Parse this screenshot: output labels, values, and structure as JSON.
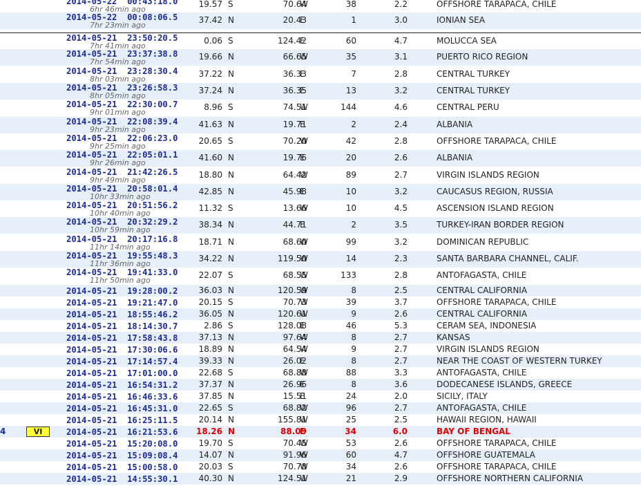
{
  "rows": [
    {
      "date": "2014-05-22",
      "time": "00:43:18.0",
      "ago": "6hr 46min ago",
      "lat": "19.57",
      "ns": "S",
      "lon": "70.64",
      "ew": "W",
      "depth": "38",
      "mag": "2.2",
      "region": "OFFSHORE TARAPACA, CHILE"
    },
    {
      "date": "2014-05-22",
      "time": "00:08:06.5",
      "ago": "7hr 23min ago",
      "lat": "37.42",
      "ns": "N",
      "lon": "20.43",
      "ew": "E",
      "depth": "1",
      "mag": "3.0",
      "region": "IONIAN SEA"
    },
    {
      "date": "2014-05-21",
      "time": "23:50:20.5",
      "ago": "7hr 41min ago",
      "lat": "0.06",
      "ns": "S",
      "lon": "124.42",
      "ew": "E",
      "depth": "60",
      "mag": "4.7",
      "region": "MOLUCCA SEA"
    },
    {
      "date": "2014-05-21",
      "time": "23:37:38.8",
      "ago": "7hr 54min ago",
      "lat": "19.66",
      "ns": "N",
      "lon": "66.65",
      "ew": "W",
      "depth": "35",
      "mag": "3.1",
      "region": "PUERTO RICO REGION"
    },
    {
      "date": "2014-05-21",
      "time": "23:28:30.4",
      "ago": "8hr 03min ago",
      "lat": "37.22",
      "ns": "N",
      "lon": "36.33",
      "ew": "E",
      "depth": "7",
      "mag": "2.8",
      "region": "CENTRAL TURKEY"
    },
    {
      "date": "2014-05-21",
      "time": "23:26:58.3",
      "ago": "8hr 05min ago",
      "lat": "37.24",
      "ns": "N",
      "lon": "36.35",
      "ew": "E",
      "depth": "13",
      "mag": "3.2",
      "region": "CENTRAL TURKEY"
    },
    {
      "date": "2014-05-21",
      "time": "22:30:00.7",
      "ago": "9hr 01min ago",
      "lat": "8.96",
      "ns": "S",
      "lon": "74.51",
      "ew": "W",
      "depth": "144",
      "mag": "4.6",
      "region": "CENTRAL PERU"
    },
    {
      "date": "2014-05-21",
      "time": "22:08:39.4",
      "ago": "9hr 23min ago",
      "lat": "41.63",
      "ns": "N",
      "lon": "19.71",
      "ew": "E",
      "depth": "2",
      "mag": "2.4",
      "region": "ALBANIA"
    },
    {
      "date": "2014-05-21",
      "time": "22:06:23.0",
      "ago": "9hr 25min ago",
      "lat": "20.65",
      "ns": "S",
      "lon": "70.20",
      "ew": "W",
      "depth": "42",
      "mag": "2.8",
      "region": "OFFSHORE TARAPACA, CHILE"
    },
    {
      "date": "2014-05-21",
      "time": "22:05:01.1",
      "ago": "9hr 26min ago",
      "lat": "41.60",
      "ns": "N",
      "lon": "19.76",
      "ew": "E",
      "depth": "20",
      "mag": "2.6",
      "region": "ALBANIA"
    },
    {
      "date": "2014-05-21",
      "time": "21:42:26.5",
      "ago": "9hr 49min ago",
      "lat": "18.80",
      "ns": "N",
      "lon": "64.42",
      "ew": "W",
      "depth": "89",
      "mag": "2.7",
      "region": "VIRGIN ISLANDS REGION"
    },
    {
      "date": "2014-05-21",
      "time": "20:58:01.4",
      "ago": "10hr 33min ago",
      "lat": "42.85",
      "ns": "N",
      "lon": "45.98",
      "ew": "E",
      "depth": "10",
      "mag": "3.2",
      "region": "CAUCASUS REGION, RUSSIA"
    },
    {
      "date": "2014-05-21",
      "time": "20:51:56.2",
      "ago": "10hr 40min ago",
      "lat": "11.32",
      "ns": "S",
      "lon": "13.66",
      "ew": "W",
      "depth": "10",
      "mag": "4.5",
      "region": "ASCENSION ISLAND REGION"
    },
    {
      "date": "2014-05-21",
      "time": "20:32:29.2",
      "ago": "10hr 59min ago",
      "lat": "38.34",
      "ns": "N",
      "lon": "44.71",
      "ew": "E",
      "depth": "2",
      "mag": "3.5",
      "region": "TURKEY-IRAN BORDER REGION"
    },
    {
      "date": "2014-05-21",
      "time": "20:17:16.8",
      "ago": "11hr 14min ago",
      "lat": "18.71",
      "ns": "N",
      "lon": "68.60",
      "ew": "W",
      "depth": "99",
      "mag": "3.2",
      "region": "DOMINICAN REPUBLIC"
    },
    {
      "date": "2014-05-21",
      "time": "19:55:48.3",
      "ago": "11hr 36min ago",
      "lat": "34.22",
      "ns": "N",
      "lon": "119.50",
      "ew": "W",
      "depth": "14",
      "mag": "2.3",
      "region": "SANTA BARBARA CHANNEL, CALIF."
    },
    {
      "date": "2014-05-21",
      "time": "19:41:33.0",
      "ago": "11hr 50min ago",
      "lat": "22.07",
      "ns": "S",
      "lon": "68.55",
      "ew": "W",
      "depth": "133",
      "mag": "2.8",
      "region": "ANTOFAGASTA, CHILE"
    },
    {
      "date": "2014-05-21",
      "time": "19:28:00.2",
      "ago": "",
      "lat": "36.03",
      "ns": "N",
      "lon": "120.59",
      "ew": "W",
      "depth": "8",
      "mag": "2.5",
      "region": "CENTRAL CALIFORNIA"
    },
    {
      "date": "2014-05-21",
      "time": "19:21:47.0",
      "ago": "",
      "lat": "20.15",
      "ns": "S",
      "lon": "70.73",
      "ew": "W",
      "depth": "39",
      "mag": "3.7",
      "region": "OFFSHORE TARAPACA, CHILE"
    },
    {
      "date": "2014-05-21",
      "time": "18:55:46.2",
      "ago": "",
      "lat": "36.05",
      "ns": "N",
      "lon": "120.61",
      "ew": "W",
      "depth": "9",
      "mag": "2.6",
      "region": "CENTRAL CALIFORNIA"
    },
    {
      "date": "2014-05-21",
      "time": "18:14:30.7",
      "ago": "",
      "lat": "2.86",
      "ns": "S",
      "lon": "128.08",
      "ew": "E",
      "depth": "46",
      "mag": "5.3",
      "region": "CERAM SEA, INDONESIA"
    },
    {
      "date": "2014-05-21",
      "time": "17:58:43.8",
      "ago": "",
      "lat": "37.13",
      "ns": "N",
      "lon": "97.64",
      "ew": "W",
      "depth": "8",
      "mag": "2.7",
      "region": "KANSAS"
    },
    {
      "date": "2014-05-21",
      "time": "17:30:06.6",
      "ago": "",
      "lat": "18.89",
      "ns": "N",
      "lon": "64.54",
      "ew": "W",
      "depth": "9",
      "mag": "2.7",
      "region": "VIRGIN ISLANDS REGION"
    },
    {
      "date": "2014-05-21",
      "time": "17:14:57.4",
      "ago": "",
      "lat": "39.33",
      "ns": "N",
      "lon": "26.02",
      "ew": "E",
      "depth": "8",
      "mag": "2.7",
      "region": "NEAR THE COAST OF WESTERN TURKEY"
    },
    {
      "date": "2014-05-21",
      "time": "17:01:00.0",
      "ago": "",
      "lat": "22.68",
      "ns": "S",
      "lon": "68.88",
      "ew": "W",
      "depth": "88",
      "mag": "3.3",
      "region": "ANTOFAGASTA, CHILE"
    },
    {
      "date": "2014-05-21",
      "time": "16:54:31.2",
      "ago": "",
      "lat": "37.37",
      "ns": "N",
      "lon": "26.96",
      "ew": "E",
      "depth": "8",
      "mag": "3.6",
      "region": "DODECANESE ISLANDS, GREECE"
    },
    {
      "date": "2014-05-21",
      "time": "16:46:33.6",
      "ago": "",
      "lat": "37.85",
      "ns": "N",
      "lon": "15.51",
      "ew": "E",
      "depth": "24",
      "mag": "2.0",
      "region": "SICILY, ITALY"
    },
    {
      "date": "2014-05-21",
      "time": "16:45:31.0",
      "ago": "",
      "lat": "22.65",
      "ns": "S",
      "lon": "68.82",
      "ew": "W",
      "depth": "96",
      "mag": "2.7",
      "region": "ANTOFAGASTA, CHILE"
    },
    {
      "date": "2014-05-21",
      "time": "16:25:11.5",
      "ago": "",
      "lat": "20.14",
      "ns": "N",
      "lon": "155.81",
      "ew": "W",
      "depth": "25",
      "mag": "2.5",
      "region": "HAWAII REGION, HAWAII"
    },
    {
      "date": "2014-05-21",
      "time": "16:21:53.6",
      "ago": "",
      "lat": "18.26",
      "ns": "N",
      "lon": "88.09",
      "ew": "E",
      "depth": "34",
      "mag": "6.0",
      "region": "BAY OF BENGAL",
      "badge": "VI",
      "num": "4"
    },
    {
      "date": "2014-05-21",
      "time": "15:20:08.0",
      "ago": "",
      "lat": "19.70",
      "ns": "S",
      "lon": "70.45",
      "ew": "W",
      "depth": "53",
      "mag": "2.6",
      "region": "OFFSHORE TARAPACA, CHILE"
    },
    {
      "date": "2014-05-21",
      "time": "15:09:08.4",
      "ago": "",
      "lat": "14.07",
      "ns": "N",
      "lon": "91.96",
      "ew": "W",
      "depth": "60",
      "mag": "4.7",
      "region": "OFFSHORE GUATEMALA"
    },
    {
      "date": "2014-05-21",
      "time": "15:00:58.0",
      "ago": "",
      "lat": "20.03",
      "ns": "S",
      "lon": "70.78",
      "ew": "W",
      "depth": "34",
      "mag": "2.6",
      "region": "OFFSHORE TARAPACA, CHILE"
    },
    {
      "date": "2014-05-21",
      "time": "14:55:30.1",
      "ago": "",
      "lat": "40.30",
      "ns": "N",
      "lon": "124.51",
      "ew": "W",
      "depth": "21",
      "mag": "2.9",
      "region": "OFFSHORE NORTHERN CALIFORNIA"
    }
  ]
}
